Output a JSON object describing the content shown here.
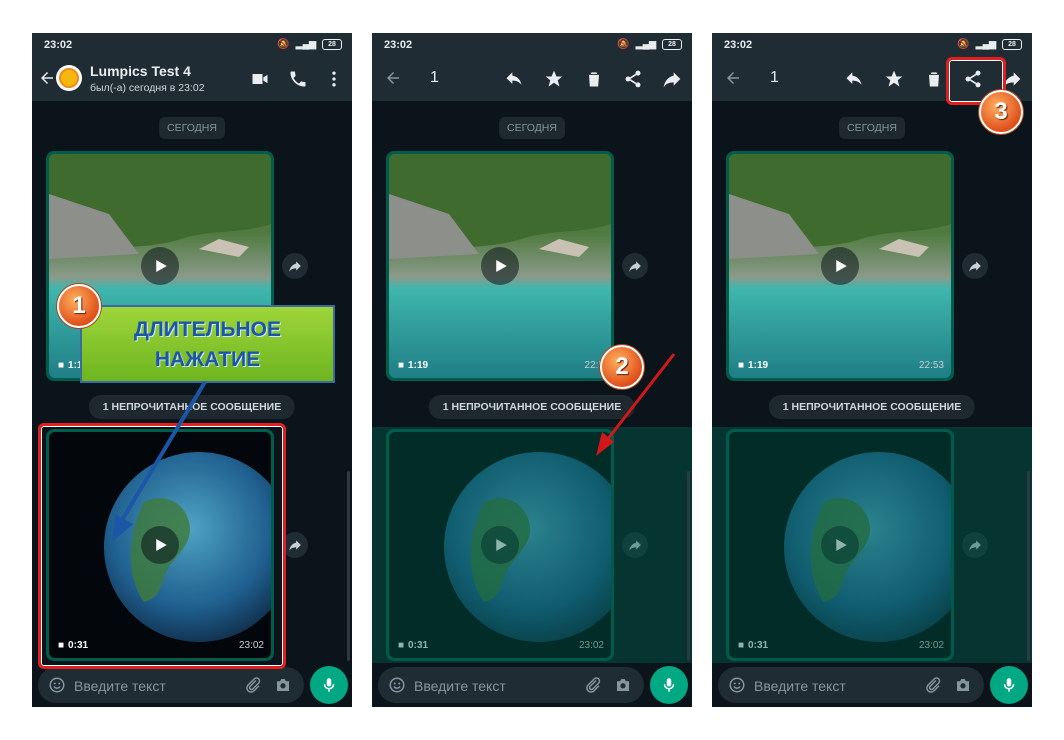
{
  "status": {
    "time": "23:02",
    "battery": "28"
  },
  "chat": {
    "contact_name": "Lumpics Test 4",
    "last_seen": "был(-а) сегодня в 23:02",
    "date_label": "СЕГОДНЯ",
    "unread_label": "1 НЕПРОЧИТАННОЕ СООБЩЕНИЕ",
    "input_placeholder": "Введите текст"
  },
  "selection": {
    "count": "1"
  },
  "videos": [
    {
      "duration": "1:19",
      "time_p2": "22:5",
      "time_p3": "22:53"
    },
    {
      "duration": "0:31",
      "time": "23:02"
    }
  ],
  "annotations": {
    "callout_line1": "ДЛИТЕЛЬНОЕ",
    "callout_line2": "НАЖАТИЕ",
    "step1": "1",
    "step2": "2",
    "step3": "3"
  },
  "colors": {
    "app_bar": "#1f2c34",
    "chat_bg": "#0b141a",
    "accent": "#00a884",
    "selection": "#005c4b",
    "highlight": "#e02020"
  },
  "icons": [
    "back-arrow-icon",
    "video-call-icon",
    "phone-icon",
    "more-vert-icon",
    "reply-icon",
    "star-icon",
    "delete-icon",
    "share-icon",
    "forward-icon",
    "play-icon",
    "emoji-icon",
    "attach-icon",
    "camera-icon",
    "mic-icon"
  ]
}
